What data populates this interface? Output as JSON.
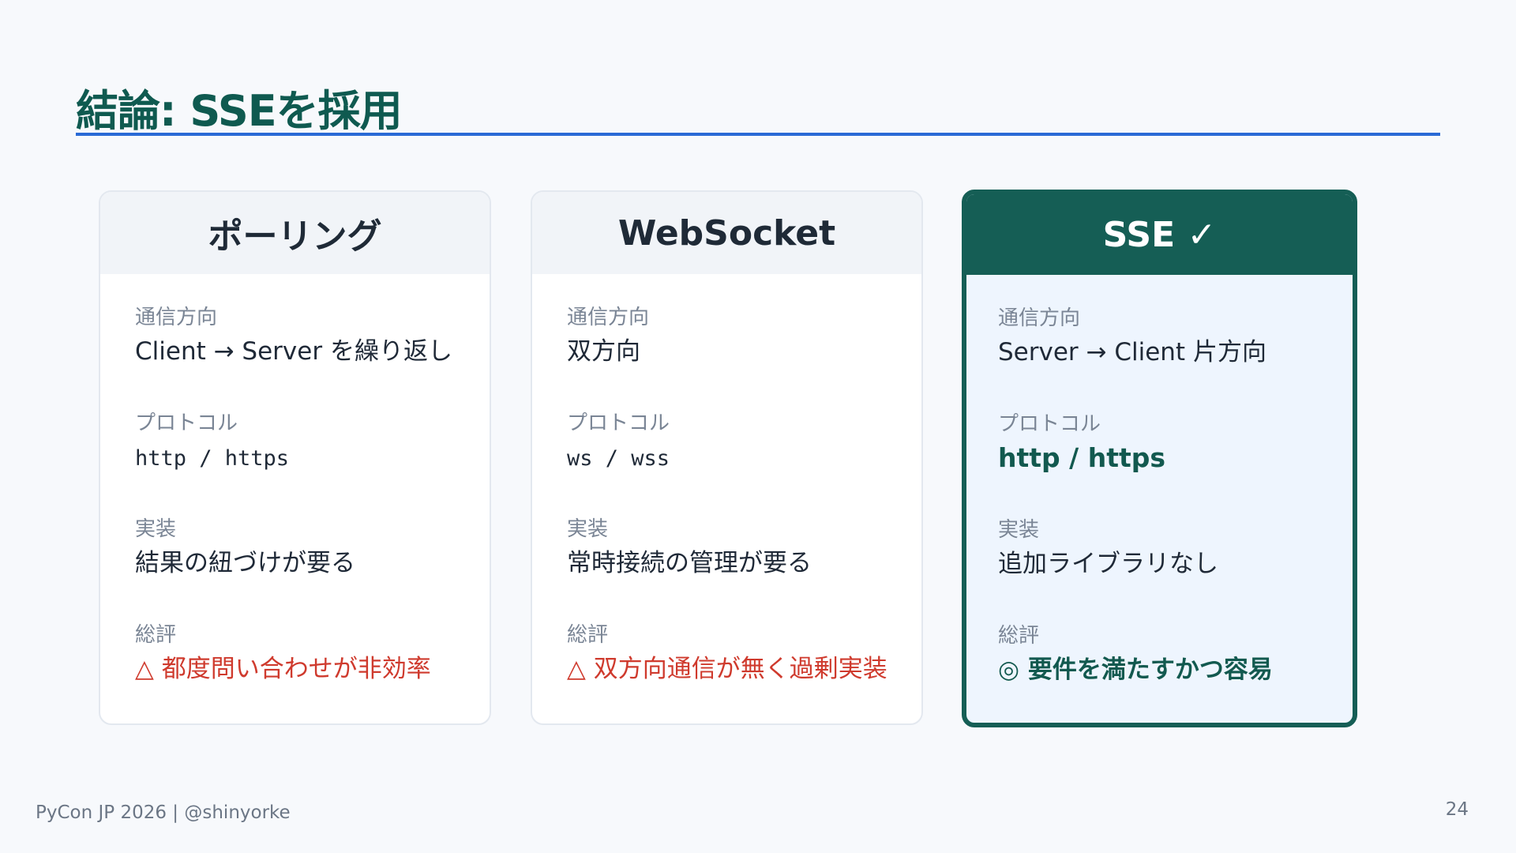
{
  "slide": {
    "title": "結論: SSEを採用",
    "footer": "PyCon JP 2026 | @shinyorke",
    "page_number": "24"
  },
  "colors": {
    "title": "#0f5a50",
    "rule": "#2a6ad6",
    "accent": "#155e55",
    "warning": "#cf3a2d",
    "selected_bg": "#eef5fe"
  },
  "cards": [
    {
      "header": "ポーリング",
      "rows": [
        {
          "label": "通信方向",
          "value": "Client → Server を繰り返し"
        },
        {
          "label": "プロトコル",
          "value": "http / https"
        },
        {
          "label": "実装",
          "value": "結果の紐づけが要る"
        },
        {
          "label": "総評",
          "value": "△ 都度問い合わせが非効率"
        }
      ]
    },
    {
      "header": "WebSocket",
      "rows": [
        {
          "label": "通信方向",
          "value": "双方向"
        },
        {
          "label": "プロトコル",
          "value": "ws / wss"
        },
        {
          "label": "実装",
          "value": "常時接続の管理が要る"
        },
        {
          "label": "総評",
          "value": "△ 双方向通信が無く過剰実装"
        }
      ]
    },
    {
      "header": "SSE ✓",
      "selected": true,
      "rows": [
        {
          "label": "通信方向",
          "value": "Server → Client 片方向"
        },
        {
          "label": "プロトコル",
          "value": "http / https"
        },
        {
          "label": "実装",
          "value": "追加ライブラリなし"
        },
        {
          "label": "総評",
          "value": "◎ 要件を満たすかつ容易"
        }
      ]
    }
  ]
}
